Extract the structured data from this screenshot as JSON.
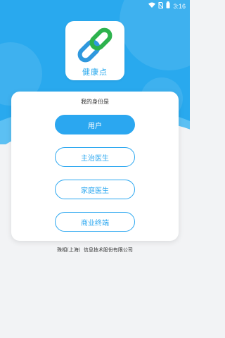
{
  "status_bar": {
    "time": "3:16",
    "icons": [
      "wifi-icon",
      "sim-off-icon",
      "battery-icon"
    ]
  },
  "logo": {
    "text": "健康点",
    "colors": {
      "link_blue": "#2f98de",
      "link_green": "#2db24d"
    }
  },
  "panel": {
    "title": "我的身份是",
    "options": [
      {
        "label": "用户",
        "style": "primary"
      },
      {
        "label": "主治医生",
        "style": "outline"
      },
      {
        "label": "家庭医生",
        "style": "outline"
      },
      {
        "label": "商业终端",
        "style": "outline"
      }
    ]
  },
  "footer": {
    "company": "殊相(上海）信息技术股份有限公司"
  },
  "colors": {
    "header_bg": "#29a9ee",
    "accent": "#2ba7f0",
    "page_bg": "#f2f3f5"
  }
}
